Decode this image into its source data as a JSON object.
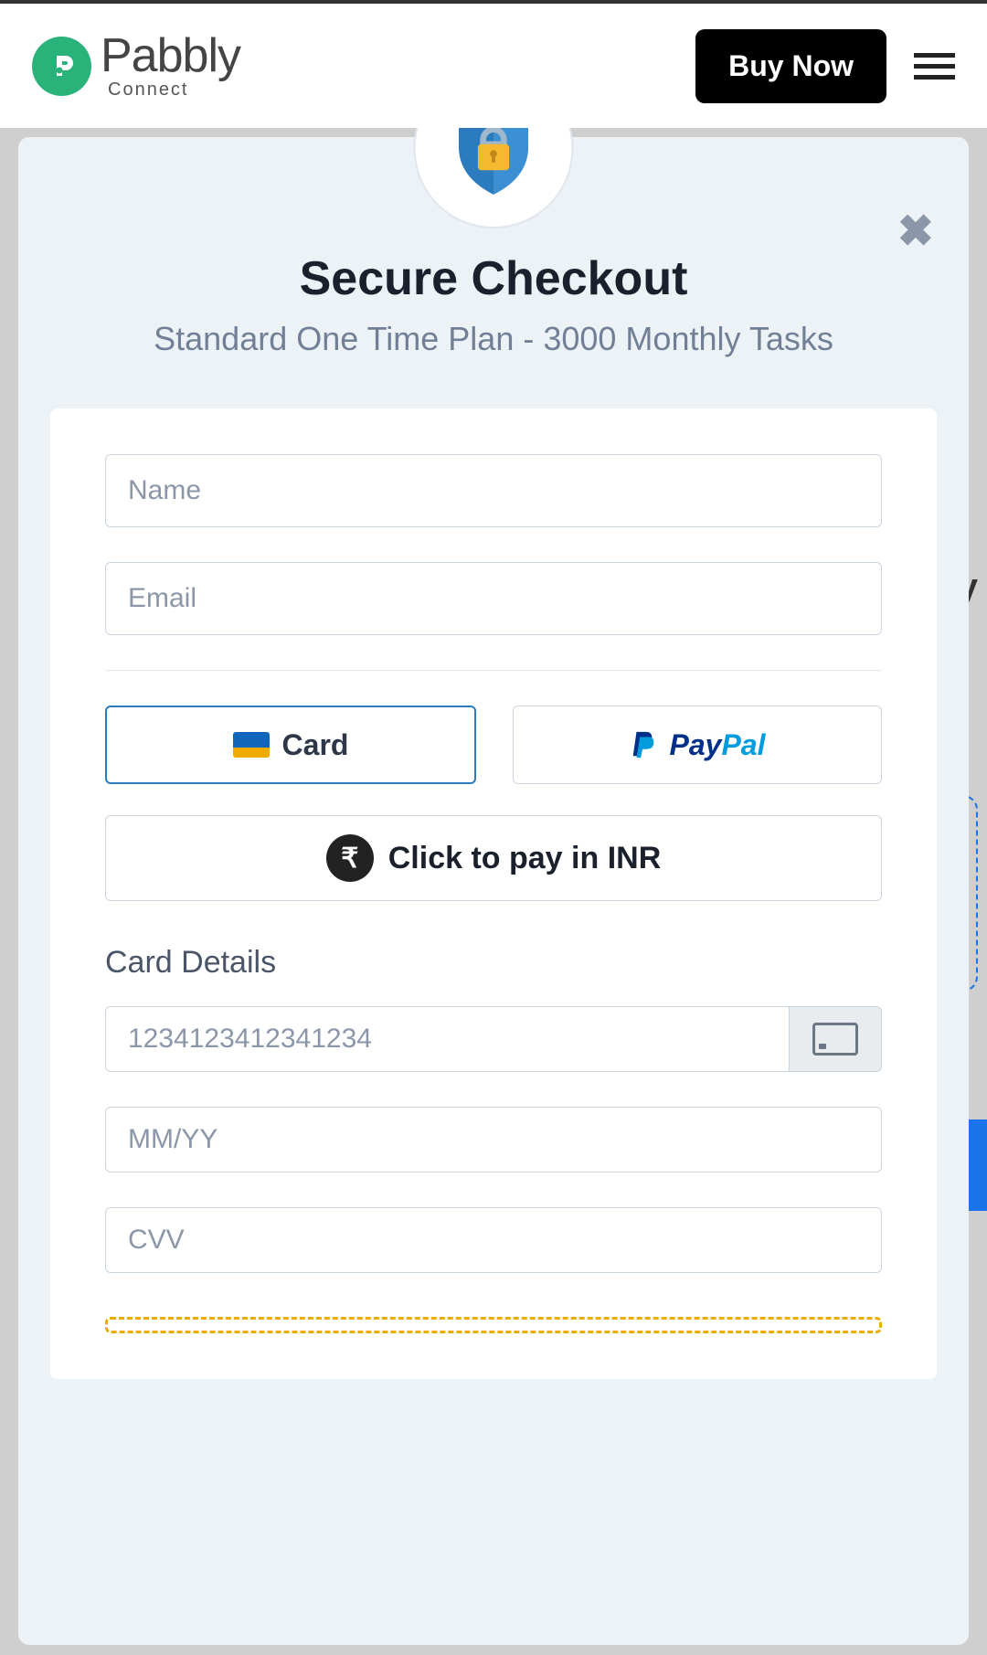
{
  "header": {
    "logo_main": "Pabbly",
    "logo_sub": "Connect",
    "buy_now_label": "Buy Now"
  },
  "backdrop": {
    "right_text_fragment": "y"
  },
  "modal": {
    "title": "Secure Checkout",
    "subtitle": "Standard One Time Plan - 3000 Monthly Tasks",
    "close_icon": "✖",
    "form": {
      "name_placeholder": "Name",
      "email_placeholder": "Email",
      "payment_methods": {
        "card_label": "Card",
        "paypal_pay": "Pay",
        "paypal_pal": "Pal"
      },
      "inr_button": {
        "rupee_symbol": "₹",
        "label": "Click to pay in INR"
      },
      "card_details_label": "Card Details",
      "card_number_placeholder": "1234123412341234",
      "expiry_placeholder": "MM/YY",
      "cvv_placeholder": "CVV"
    }
  }
}
